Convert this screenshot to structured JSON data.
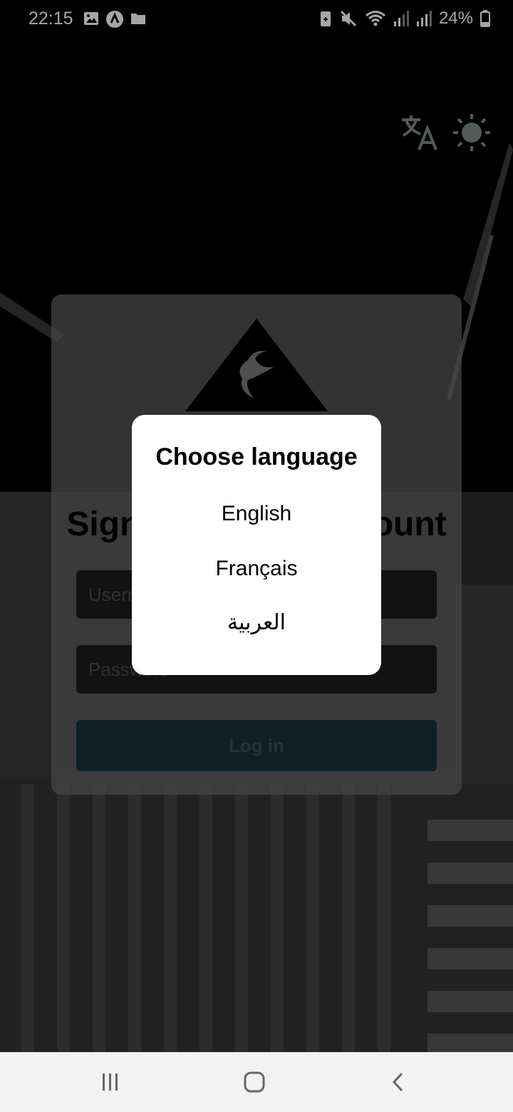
{
  "status_bar": {
    "time": "22:15",
    "left_icons": [
      "gallery-icon",
      "app-icon",
      "folder-icon"
    ],
    "right_icons": [
      "battery-saver-icon",
      "mute-icon",
      "wifi-icon",
      "signal-icon",
      "signal-icon"
    ],
    "battery": "24%"
  },
  "top_actions": {
    "translate_icon": "translate-icon",
    "theme_icon": "sun-icon"
  },
  "login": {
    "title": "Sign in to your account",
    "username_placeholder": "Username",
    "password_placeholder": "Password",
    "login_label": "Log in"
  },
  "language_dialog": {
    "title": "Choose language",
    "options": [
      "English",
      "Français",
      "العربية"
    ]
  },
  "nav_bar": {
    "icons": [
      "recent-apps-icon",
      "home-icon",
      "back-icon"
    ]
  },
  "colors": {
    "card": "#6e6e6e",
    "field": "#1d1d1d",
    "login_button": "#18323a",
    "dialog": "#ffffff",
    "accent_icons": "#7e8b89"
  }
}
